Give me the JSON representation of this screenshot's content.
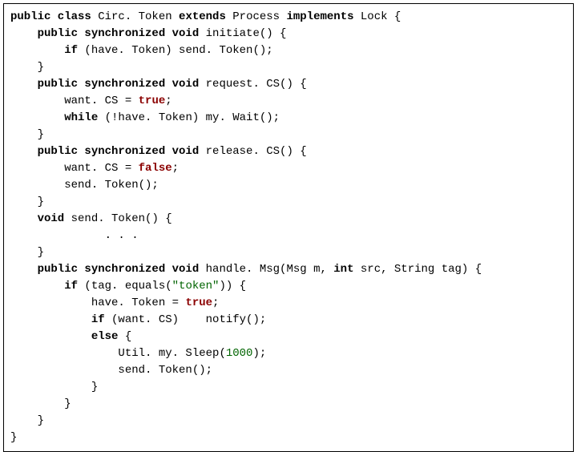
{
  "code": {
    "l1": {
      "a": "public class ",
      "b": "Circ. Token ",
      "c": "extends ",
      "d": "Process ",
      "e": "implements ",
      "f": "Lock {"
    },
    "l2": {
      "a": "    public synchronized void ",
      "b": "initiate() {"
    },
    "l3": {
      "a": "        if ",
      "b": "(have. Token) send. Token();"
    },
    "l4": "    }",
    "l5": {
      "a": "    public synchronized void ",
      "b": "request. CS() {"
    },
    "l6": {
      "a": "        want. CS = ",
      "b": "true",
      "c": ";"
    },
    "l7": {
      "a": "        while ",
      "b": "(!have. Token) my. Wait();"
    },
    "l8": "    }",
    "l9": {
      "a": "    public synchronized void ",
      "b": "release. CS() {"
    },
    "l10": {
      "a": "        want. CS = ",
      "b": "false",
      "c": ";"
    },
    "l11": "        send. Token();",
    "l12": "    }",
    "l13": {
      "a": "    void ",
      "b": "send. Token() {"
    },
    "l14": "              . . .",
    "l15": "    }",
    "l16": {
      "a": "    public synchronized void ",
      "b": "handle. Msg(Msg m, ",
      "c": "int ",
      "d": "src, String tag) {"
    },
    "l17": {
      "a": "        if ",
      "b": "(tag. equals(",
      "c": "\"token\"",
      "d": ")) {"
    },
    "l18": {
      "a": "            have. Token = ",
      "b": "true",
      "c": ";"
    },
    "l19": {
      "a": "            if ",
      "b": "(want. CS)    notify();"
    },
    "l20": {
      "a": "            else ",
      "b": "{"
    },
    "l21": {
      "a": "                Util. my. Sleep(",
      "b": "1000",
      "c": ");"
    },
    "l22": "                send. Token();",
    "l23": "            }",
    "l24": "        }",
    "l25": "    }",
    "l26": "}"
  }
}
